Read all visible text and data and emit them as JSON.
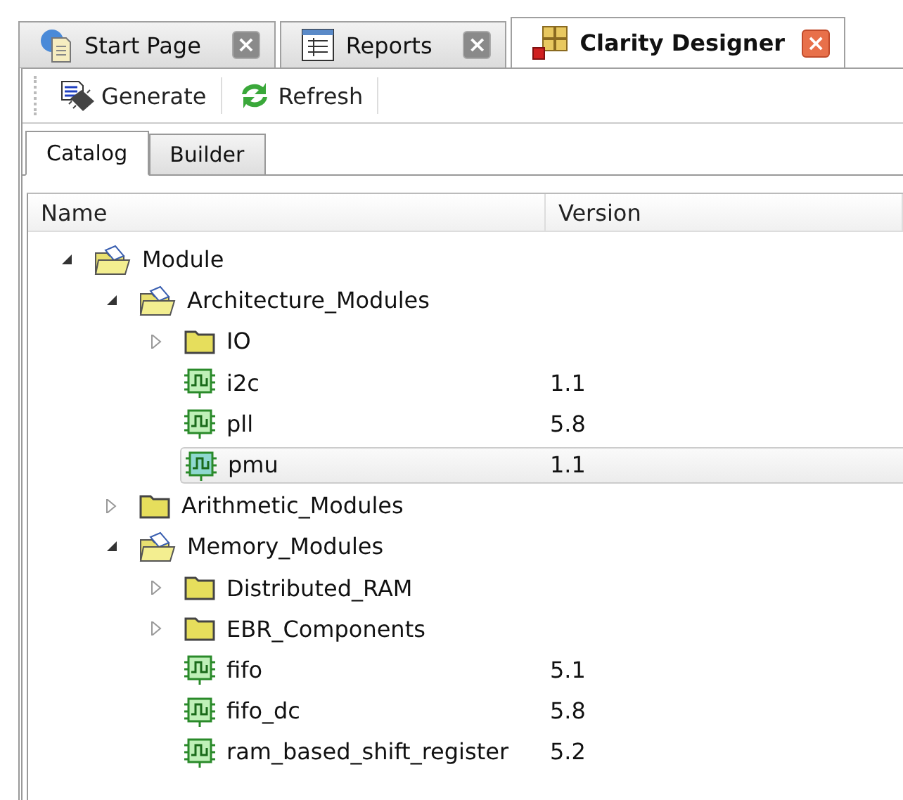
{
  "doc_tabs": [
    {
      "label": "Start Page",
      "selected": false,
      "close": "×"
    },
    {
      "label": "Reports",
      "selected": false,
      "close": "×"
    },
    {
      "label": "Clarity Designer",
      "selected": true,
      "close": "×"
    }
  ],
  "toolbar": [
    {
      "label": "Generate"
    },
    {
      "label": "Refresh"
    }
  ],
  "panel_tabs": [
    {
      "label": "Catalog",
      "selected": true
    },
    {
      "label": "Builder",
      "selected": false
    }
  ],
  "tree": {
    "columns": [
      "Name",
      "Version"
    ],
    "nodes": [
      {
        "kind": "folder",
        "name": "Module",
        "expanded": true,
        "children": [
          {
            "kind": "folder",
            "name": "Architecture_Modules",
            "expanded": true,
            "children": [
              {
                "kind": "folder",
                "name": "IO",
                "expanded": false
              },
              {
                "kind": "module",
                "name": "i2c",
                "version": "1.1",
                "selected": false
              },
              {
                "kind": "module",
                "name": "pll",
                "version": "5.8",
                "selected": false
              },
              {
                "kind": "module",
                "name": "pmu",
                "version": "1.1",
                "selected": true
              }
            ]
          },
          {
            "kind": "folder",
            "name": "Arithmetic_Modules",
            "expanded": false
          },
          {
            "kind": "folder",
            "name": "Memory_Modules",
            "expanded": true,
            "children": [
              {
                "kind": "folder",
                "name": "Distributed_RAM",
                "expanded": false
              },
              {
                "kind": "folder",
                "name": "EBR_Components",
                "expanded": false
              },
              {
                "kind": "module",
                "name": "fifo",
                "version": "5.1",
                "selected": false
              },
              {
                "kind": "module",
                "name": "fifo_dc",
                "version": "5.8",
                "selected": false
              },
              {
                "kind": "module",
                "name": "ram_based_shift_register",
                "version": "5.2",
                "selected": false
              }
            ]
          }
        ]
      }
    ]
  }
}
